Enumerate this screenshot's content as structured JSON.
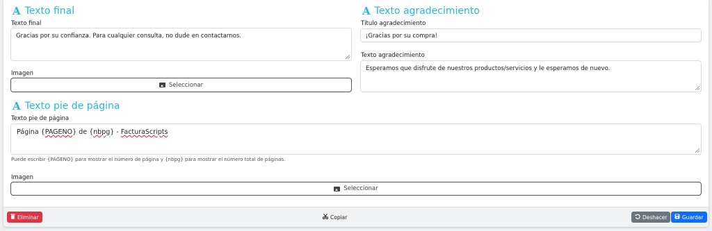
{
  "texto_final": {
    "section_title": "Texto final",
    "field_label": "Texto final",
    "field_value": "Gracias por su confianza. Para cualquier consulta, no dude en contactarnos.",
    "image_label": "Imagen",
    "select_button": "Seleccionar"
  },
  "texto_agradecimiento": {
    "section_title": "Texto agradecimiento",
    "title_label": "Título agradecimiento",
    "title_value": "¡Gracias por su compra!",
    "text_label": "Texto agradecimiento",
    "text_value": "Esperamos que disfrute de nuestros productos/servicios y le esperamos de nuevo."
  },
  "texto_pie": {
    "section_title": "Texto pie de página",
    "field_label": "Texto pie de página",
    "value_parts": [
      "Página",
      " {",
      "PAGENO",
      "} de {",
      "nbpg",
      "} - ",
      "FacturaScripts"
    ],
    "help_text": "Puede escribir {PAGENO} para mostrar el número de página y {nbpg} para mostrar el número total de páginas.",
    "image_label": "Imagen",
    "select_button": "Seleccionar"
  },
  "footer": {
    "delete_button": "Eliminar",
    "copy_button": "Copiar",
    "undo_button": "Deshacer",
    "save_button": "Guardar"
  },
  "colors": {
    "accent": "#29b6d6",
    "danger": "#dc3545",
    "secondary": "#6c757d",
    "primary": "#0d6efd"
  },
  "icons": [
    "font-a-icon",
    "image-icon",
    "trash-icon",
    "scissors-icon",
    "undo-icon",
    "save-icon",
    "resize-grip-icon"
  ]
}
